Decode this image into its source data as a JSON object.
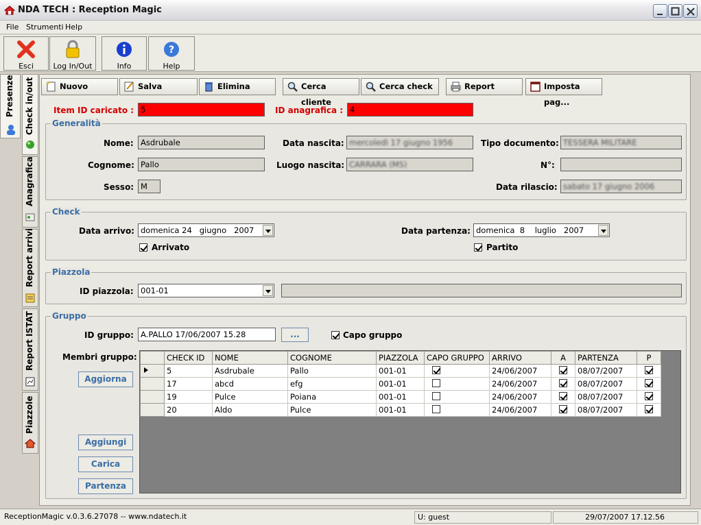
{
  "window": {
    "title": "NDA TECH : Reception Magic"
  },
  "menu": [
    "File",
    "Strumenti",
    "Help"
  ],
  "toolbar": {
    "esci": "Esci",
    "login": "Log In/Out",
    "info": "Info",
    "help": "Help"
  },
  "vtabs_outer": [
    "Presenze"
  ],
  "vtabs_inner": [
    "Check in/out",
    "Anagrafica",
    "Report arrivi",
    "Report ISTAT",
    "Piazzole"
  ],
  "actions": {
    "nuovo": "Nuovo",
    "salva": "Salva",
    "elimina": "Elimina",
    "cerca_cliente": "Cerca cliente",
    "cerca_check": "Cerca check",
    "report": "Report",
    "imposta": "Imposta pag..."
  },
  "header": {
    "item_id_label": "Item ID caricato :",
    "item_id": "5",
    "id_anag_label": "ID anagrafica :",
    "id_anag": "4"
  },
  "generalita": {
    "title": "Generalità",
    "nome_label": "Nome:",
    "nome": "Asdrubale",
    "cognome_label": "Cognome:",
    "cognome": "Pallo",
    "sesso_label": "Sesso:",
    "sesso": "M",
    "data_nascita_label": "Data nascita:",
    "data_nascita": "mercoledì 17 giugno 1956",
    "luogo_nascita_label": "Luogo nascita:",
    "luogo_nascita": "CARRARA (MS)",
    "tipo_doc_label": "Tipo documento:",
    "tipo_doc": "TESSERA MILITARE",
    "numero_label": "N°:",
    "numero": "",
    "data_rilascio_label": "Data rilascio:",
    "data_rilascio": "sabato 17 giugno 2006"
  },
  "check": {
    "title": "Check",
    "arrivo_label": "Data arrivo:",
    "arrivo": "domenica 24   giugno   2007",
    "arrivato_label": "Arrivato",
    "arrivato": true,
    "partenza_label": "Data partenza:",
    "partenza": "domenica  8    luglio   2007",
    "partito_label": "Partito",
    "partito": true
  },
  "piazzola": {
    "title": "Piazzola",
    "id_label": "ID piazzola:",
    "id": "001-01",
    "desc": ""
  },
  "gruppo": {
    "title": "Gruppo",
    "id_label": "ID gruppo:",
    "id": "A.PALLO 17/06/2007 15.28",
    "browse": "...",
    "capo_label": "Capo gruppo",
    "capo": true,
    "membri_label": "Membri gruppo:",
    "aggiorna": "Aggiorna",
    "aggiungi": "Aggiungi",
    "carica": "Carica",
    "partenza": "Partenza"
  },
  "table": {
    "columns": [
      "CHECK ID",
      "NOME",
      "COGNOME",
      "PIAZZOLA",
      "CAPO GRUPPO",
      "ARRIVO",
      "A",
      "PARTENZA",
      "P"
    ],
    "rows": [
      {
        "check_id": "5",
        "nome": "Asdrubale",
        "cognome": "Pallo",
        "piazzola": "001-01",
        "capo": true,
        "arrivo": "24/06/2007",
        "a": true,
        "partenza": "08/07/2007",
        "p": true,
        "current": true
      },
      {
        "check_id": "17",
        "nome": "abcd",
        "cognome": "efg",
        "piazzola": "001-01",
        "capo": false,
        "arrivo": "24/06/2007",
        "a": true,
        "partenza": "08/07/2007",
        "p": true,
        "current": false
      },
      {
        "check_id": "19",
        "nome": "Pulce",
        "cognome": "Poiana",
        "piazzola": "001-01",
        "capo": false,
        "arrivo": "24/06/2007",
        "a": true,
        "partenza": "08/07/2007",
        "p": true,
        "current": false
      },
      {
        "check_id": "20",
        "nome": "Aldo",
        "cognome": "Pulce",
        "piazzola": "001-01",
        "capo": false,
        "arrivo": "24/06/2007",
        "a": true,
        "partenza": "08/07/2007",
        "p": true,
        "current": false
      }
    ]
  },
  "status": {
    "version": "ReceptionMagic v.0.3.6.27078 -- www.ndatech.it",
    "user": "U: guest",
    "datetime": "29/07/2007 17.12.56"
  }
}
